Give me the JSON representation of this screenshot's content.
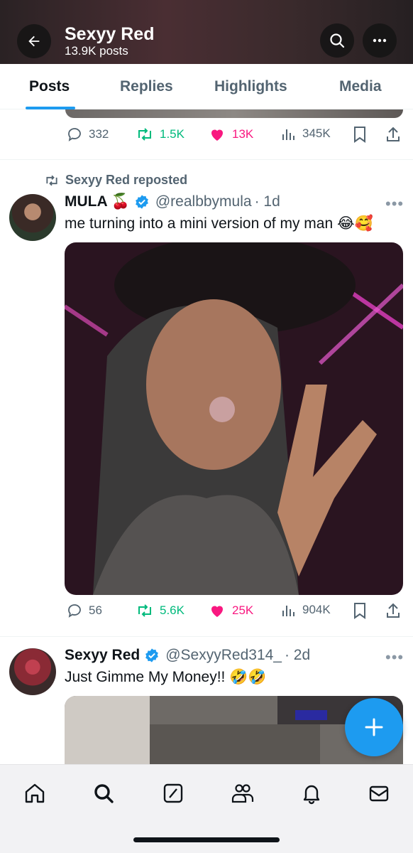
{
  "header": {
    "title": "Sexyy Red",
    "post_count": "13.9K posts"
  },
  "tabs": [
    {
      "label": "Posts",
      "active": true
    },
    {
      "label": "Replies",
      "active": false
    },
    {
      "label": "Highlights",
      "active": false
    },
    {
      "label": "Media",
      "active": false
    }
  ],
  "tweets": [
    {
      "actions": {
        "replies": "332",
        "reposts": "1.5K",
        "likes": "13K",
        "views": "345K"
      }
    },
    {
      "repost_label": "Sexyy Red reposted",
      "author": "MULA 🍒",
      "verified": true,
      "handle": "@realbbymula",
      "time": "· 1d",
      "text": "me turning into a mini version of my man 😂🥰",
      "actions": {
        "replies": "56",
        "reposts": "5.6K",
        "likes": "25K",
        "views": "904K"
      }
    },
    {
      "author": "Sexyy Red",
      "verified": true,
      "handle": "@SexyyRed314_",
      "time": "· 2d",
      "text": "Just Gimme My Money!! 🤣🤣"
    }
  ],
  "icons": {
    "back": "arrow-left-icon",
    "search": "search-icon",
    "more": "more-icon",
    "compose": "plus-icon",
    "nav": [
      "home-icon",
      "search-icon",
      "grok-icon",
      "communities-icon",
      "bell-icon",
      "mail-icon"
    ]
  },
  "colors": {
    "accent": "#1d9bf0",
    "repost": "#00ba7c",
    "like": "#f91880",
    "muted": "#536471"
  }
}
